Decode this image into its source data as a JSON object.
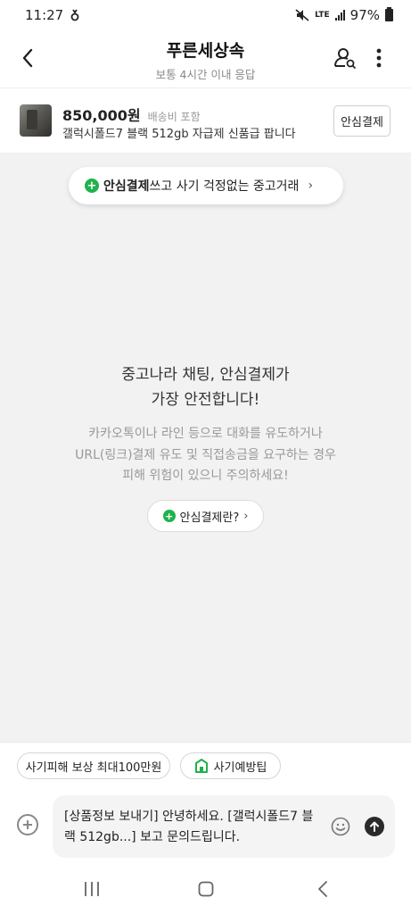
{
  "status_bar": {
    "time": "11:27",
    "network": "LTE",
    "battery": "97%"
  },
  "header": {
    "title": "푸른세상속",
    "subtitle": "보통 4시간 이내 응답"
  },
  "product": {
    "price": "850,000원",
    "shipping": "배송비 포함",
    "title": "갤럭시폴드7 블랙 512gb 자급제 신품급 팝니다",
    "safe_pay_button": "안심결제"
  },
  "chat": {
    "top_pill": {
      "bold": "안심결제",
      "rest": "쓰고 사기 걱정없는 중고거래"
    },
    "notice_heading": [
      "중고나라 채팅, 안심결제가",
      "가장 안전합니다!"
    ],
    "notice_body": [
      "카카오톡이나 라인 등으로 대화를 유도하거나",
      "URL(링크)결제 유도 및 직접송금을 요구하는 경우",
      "피해 위험이 있으니 주의하세요!"
    ],
    "mid_pill": "안심결제란?"
  },
  "chips": {
    "compensation": "사기피해 보상 최대100만원",
    "fraud_tips": "사기예방팁"
  },
  "composer": {
    "message": "[상품정보 보내기] 안녕하세요. [갤럭시폴드7 블랙 512gb...] 보고 문의드립니다."
  },
  "colors": {
    "accent_green": "#1fb24d",
    "chat_background": "#f2f2f2"
  },
  "icons": {
    "back": "chevron-left-icon",
    "profile_search": "user-search-icon",
    "more": "more-vertical-icon",
    "plus_badge": "plus-circle-icon",
    "add": "add-circle-icon",
    "emoji": "emoji-icon",
    "send": "send-arrow-icon",
    "home_shield": "shield-home-icon"
  }
}
